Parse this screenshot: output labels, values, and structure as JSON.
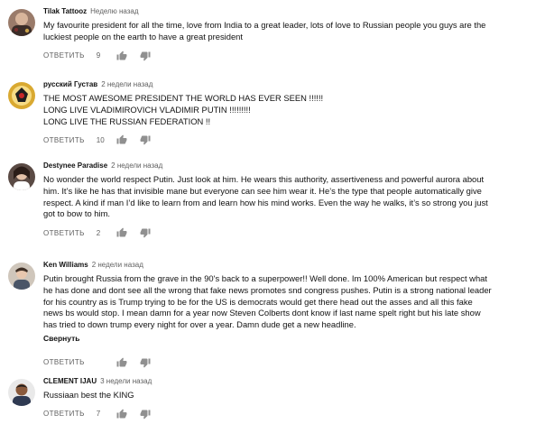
{
  "comments": [
    {
      "author": "Tilak Tattooz",
      "time": "Неделю назад",
      "lines": [
        "My favourite president for all the time, love from India to a great leader, lots of love to Russian people you guys are the",
        "luckiest people on the earth to have a great president"
      ],
      "reply_label": "ОТВЕТИТЬ",
      "likes": "9",
      "collapse_label": "",
      "avatar": "tattoo-avatar"
    },
    {
      "author": "русский Густав",
      "time": "2 недели назад",
      "lines": [
        "THE MOST AWESOME PRESIDENT THE WORLD HAS EVER SEEN !!!!!!",
        "LONG LIVE VLADIMIROVICH VLADIMIR PUTIN !!!!!!!!!",
        "LONG LIVE THE RUSSIAN FEDERATION !!"
      ],
      "reply_label": "ОТВЕТИТЬ",
      "likes": "10",
      "collapse_label": "",
      "avatar": "emblem-avatar"
    },
    {
      "author": "Destynee Paradise",
      "time": "2 недели назад",
      "lines": [
        "No wonder the world respect Putin. Just look at him. He wears this authority, assertiveness and powerful aurora about",
        "him. It’s like he has that invisible mane but everyone can see him wear it. He’s the type that people automatically give",
        "respect. A kind if man I’d like to  learn from and learn how his mind works. Even the way he walks, it’s so strong you just",
        "got to bow to him."
      ],
      "reply_label": "ОТВЕТИТЬ",
      "likes": "2",
      "collapse_label": "",
      "avatar": "portrait-avatar"
    },
    {
      "author": "Ken Williams",
      "time": "2 недели назад",
      "lines": [
        "Putin brought Russia from the grave in the 90's back to a superpower!! Well done. Im 100% American but respect what",
        "he has done and dont see all the wrong that fake news promotes snd congress pushes. Putin is a strong national leader",
        "for his country as is Trump trying to be for the US is democrats would get there head out the asses and all this fake",
        "news bs would stop. I mean damn for a year now Steven Colberts dont know if last name spelt right but his late show",
        "has tried to down trump every night for over a year. Damn dude get a new headline."
      ],
      "reply_label": "ОТВЕТИТЬ",
      "likes": "",
      "collapse_label": "Свернуть",
      "avatar": "person-avatar"
    },
    {
      "author": "CLEMENT IJAU",
      "time": "3 недели назад",
      "lines": [
        "Russiaan best the KING"
      ],
      "reply_label": "ОТВЕТИТЬ",
      "likes": "7",
      "collapse_label": "",
      "avatar": "man-avatar"
    }
  ]
}
